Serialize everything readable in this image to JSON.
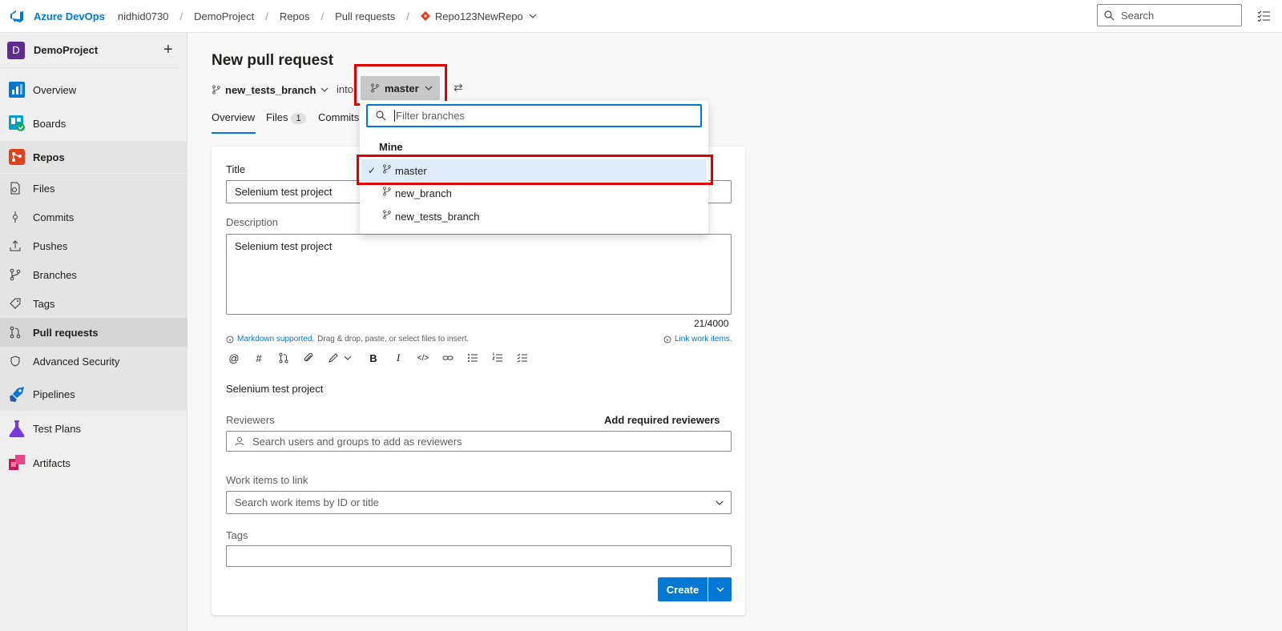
{
  "topbar": {
    "brand": "Azure DevOps",
    "breadcrumbs": [
      "nidhid0730",
      "DemoProject",
      "Repos",
      "Pull requests",
      "Repo123NewRepo"
    ],
    "search_placeholder": "Search"
  },
  "sidebar": {
    "project_initial": "D",
    "project_name": "DemoProject",
    "items": [
      {
        "label": "Overview"
      },
      {
        "label": "Boards"
      },
      {
        "label": "Repos"
      },
      {
        "label": "Files"
      },
      {
        "label": "Commits"
      },
      {
        "label": "Pushes"
      },
      {
        "label": "Branches"
      },
      {
        "label": "Tags"
      },
      {
        "label": "Pull requests"
      },
      {
        "label": "Advanced Security"
      },
      {
        "label": "Pipelines"
      },
      {
        "label": "Test Plans"
      },
      {
        "label": "Artifacts"
      }
    ]
  },
  "main": {
    "title": "New pull request",
    "source_branch": "new_tests_branch",
    "into": "into",
    "target_branch": "master",
    "tabs": [
      {
        "label": "Overview"
      },
      {
        "label": "Files",
        "badge": "1"
      },
      {
        "label": "Commits"
      }
    ]
  },
  "form": {
    "title_label": "Title",
    "title_value": "Selenium test project",
    "description_label": "Description",
    "description_value": "Selenium test project",
    "char_count": "21/4000",
    "markdown_link": "Markdown supported.",
    "markdown_hint": "Drag & drop, paste, or select files to insert.",
    "link_work_items": "Link work items.",
    "preview_text": "Selenium test project",
    "reviewers_label": "Reviewers",
    "add_required_reviewers": "Add required reviewers",
    "reviewers_placeholder": "Search users and groups to add as reviewers",
    "work_items_label": "Work items to link",
    "work_items_placeholder": "Search work items by ID or title",
    "tags_label": "Tags",
    "create_label": "Create"
  },
  "branch_dropdown": {
    "filter_placeholder": "Filter branches",
    "section": "Mine",
    "branches": [
      {
        "name": "master",
        "selected": true
      },
      {
        "name": "new_branch",
        "selected": false
      },
      {
        "name": "new_tests_branch",
        "selected": false
      }
    ]
  },
  "colors": {
    "accent": "#0078d4",
    "highlight_border": "#e00000",
    "selected_row": "#deecf9"
  }
}
